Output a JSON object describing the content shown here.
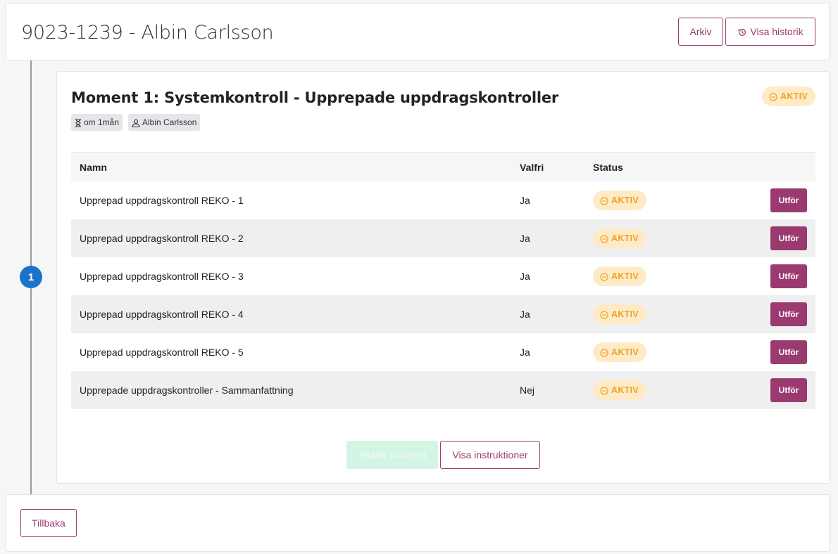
{
  "header": {
    "title": "9023-1239 - Albin Carlsson",
    "archive_label": "Arkiv",
    "history_label": "Visa historik"
  },
  "timeline": {
    "step_number": "1"
  },
  "moment": {
    "title": "Moment 1: Systemkontroll - Upprepade uppdragskontroller",
    "status": "AKTIV",
    "due": "om 1mån",
    "assignee": "Albin Carlsson",
    "table": {
      "headers": {
        "name": "Namn",
        "optional": "Valfri",
        "status": "Status"
      },
      "rows": [
        {
          "name": "Upprepad uppdragskontroll REKO - 1",
          "optional": "Ja",
          "status": "AKTIV",
          "action": "Utför"
        },
        {
          "name": "Upprepad uppdragskontroll REKO - 2",
          "optional": "Ja",
          "status": "AKTIV",
          "action": "Utför"
        },
        {
          "name": "Upprepad uppdragskontroll REKO - 3",
          "optional": "Ja",
          "status": "AKTIV",
          "action": "Utför"
        },
        {
          "name": "Upprepad uppdragskontroll REKO - 4",
          "optional": "Ja",
          "status": "AKTIV",
          "action": "Utför"
        },
        {
          "name": "Upprepad uppdragskontroll REKO - 5",
          "optional": "Ja",
          "status": "AKTIV",
          "action": "Utför"
        },
        {
          "name": "Upprepade uppdragskontroller - Sammanfattning",
          "optional": "Nej",
          "status": "AKTIV",
          "action": "Utför"
        }
      ]
    },
    "complete_label": "Slutför moment",
    "instructions_label": "Visa instruktioner"
  },
  "footer": {
    "back_label": "Tillbaka"
  },
  "colors": {
    "brand": "#9b3a6f",
    "status_active_bg": "#fdebc8",
    "status_active_fg": "#f0a020",
    "step_circle": "#1a73c8",
    "complete_disabled_bg": "#d3f5e3"
  },
  "icons": {
    "status": "minus-circle-icon",
    "history": "history-icon",
    "due": "hourglass-icon",
    "assignee": "user-icon"
  }
}
